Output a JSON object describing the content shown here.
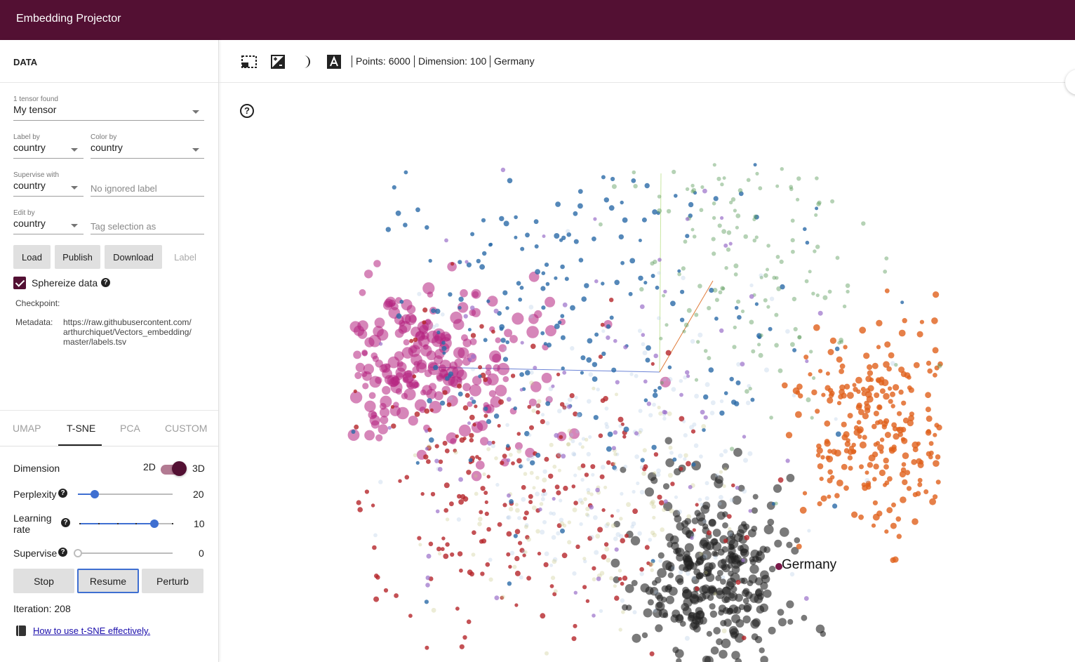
{
  "app": {
    "title": "Embedding Projector"
  },
  "colors": {
    "brand": "#531033",
    "accent": "#3f6fd1"
  },
  "data_panel": {
    "heading": "DATA",
    "tensor": {
      "caption": "1 tensor found",
      "value": "My tensor"
    },
    "label_by": {
      "caption": "Label by",
      "value": "country"
    },
    "color_by": {
      "caption": "Color by",
      "value": "country"
    },
    "supervise_with": {
      "caption": "Supervise with",
      "value": "country"
    },
    "ignored_label": {
      "placeholder": "No ignored label"
    },
    "edit_by": {
      "caption": "Edit by",
      "value": "country"
    },
    "tag_selection": {
      "placeholder": "Tag selection as"
    },
    "buttons": {
      "load": "Load",
      "publish": "Publish",
      "download": "Download",
      "label": "Label"
    },
    "sphereize": {
      "label": "Sphereize data",
      "checked": true
    },
    "checkpoint_label": "Checkpoint:",
    "metadata_label": "Metadata:",
    "metadata_lines": [
      "https://raw.githubusercontent.com/",
      "arthurchiquet/Vectors_embedding/",
      "master/labels.tsv"
    ]
  },
  "tabs": {
    "umap": "UMAP",
    "tsne": "T-SNE",
    "pca": "PCA",
    "custom": "CUSTOM",
    "active": "T-SNE"
  },
  "tsne": {
    "dimension_label": "Dimension",
    "dim_2d": "2D",
    "dim_3d": "3D",
    "dimension_selected": "3D",
    "perplexity_label": "Perplexity",
    "perplexity_value": "20",
    "perplexity_fraction": 0.18,
    "learning_rate_label_1": "Learning",
    "learning_rate_label_2": "rate",
    "learning_rate_value": "10",
    "learning_rate_fraction": 0.8,
    "supervise_label": "Supervise",
    "supervise_value": "0",
    "supervise_fraction": 0,
    "buttons": {
      "stop": "Stop",
      "resume": "Resume",
      "perturb": "Perturb"
    },
    "iteration_text": "Iteration: 208",
    "help_link": "How to use t-SNE effectively."
  },
  "toolbar": {
    "points": "Points: 6000",
    "dimension": "Dimension: 100",
    "selected": "Germany",
    "icons": [
      "select-rectangle-icon",
      "night-mode-icon",
      "moon-icon",
      "label-text-icon"
    ]
  },
  "projection": {
    "selected_point_label": "Germany",
    "clusters": [
      {
        "color": "#b4237f",
        "count": 260
      },
      {
        "color": "#222222",
        "count": 330
      },
      {
        "color": "#e0601b",
        "count": 260
      },
      {
        "color": "#b5262b",
        "count": 240
      },
      {
        "color": "#2a6aa8",
        "count": 230
      },
      {
        "color": "#5a9b5a",
        "count": 170
      },
      {
        "color": "#a8c4e0",
        "count": 200
      },
      {
        "color": "#c9c98a",
        "count": 120
      },
      {
        "color": "#9a6fc9",
        "count": 90
      }
    ]
  }
}
